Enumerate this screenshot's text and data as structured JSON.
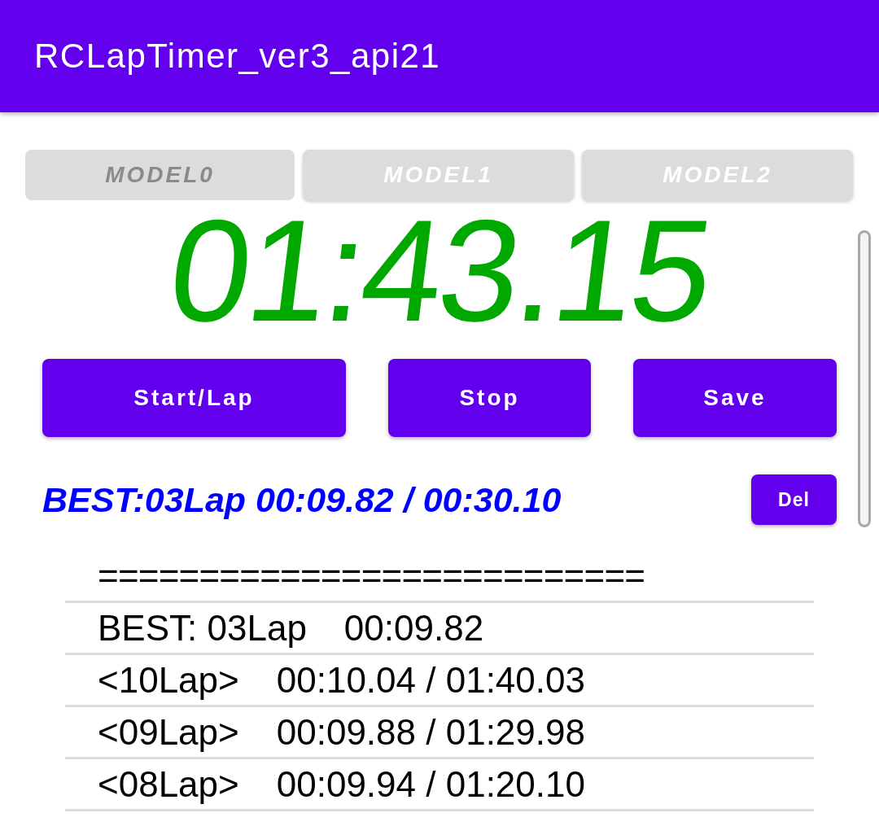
{
  "app_bar": {
    "title": "RCLapTimer_ver3_api21"
  },
  "model_tabs": [
    {
      "label": "MODEL0",
      "selected": true
    },
    {
      "label": "MODEL1",
      "selected": false
    },
    {
      "label": "MODEL2",
      "selected": false
    }
  ],
  "timer": {
    "display": "01:43.15"
  },
  "buttons": [
    "Start/Lap",
    "Stop",
    "Save"
  ],
  "best_summary": {
    "text": "BEST:03Lap 00:09.82 / 00:30.10",
    "delete_button": "Del"
  },
  "lap_list": {
    "header": "===========================",
    "rows": [
      {
        "lap": "BEST: 03Lap",
        "time": "00:09.82"
      },
      {
        "lap": "<10Lap>",
        "time": "00:10.04 / 01:40.03"
      },
      {
        "lap": "<09Lap>",
        "time": "00:09.88 / 01:29.98"
      },
      {
        "lap": "<08Lap>",
        "time": "00:09.94 / 01:20.10"
      }
    ]
  }
}
